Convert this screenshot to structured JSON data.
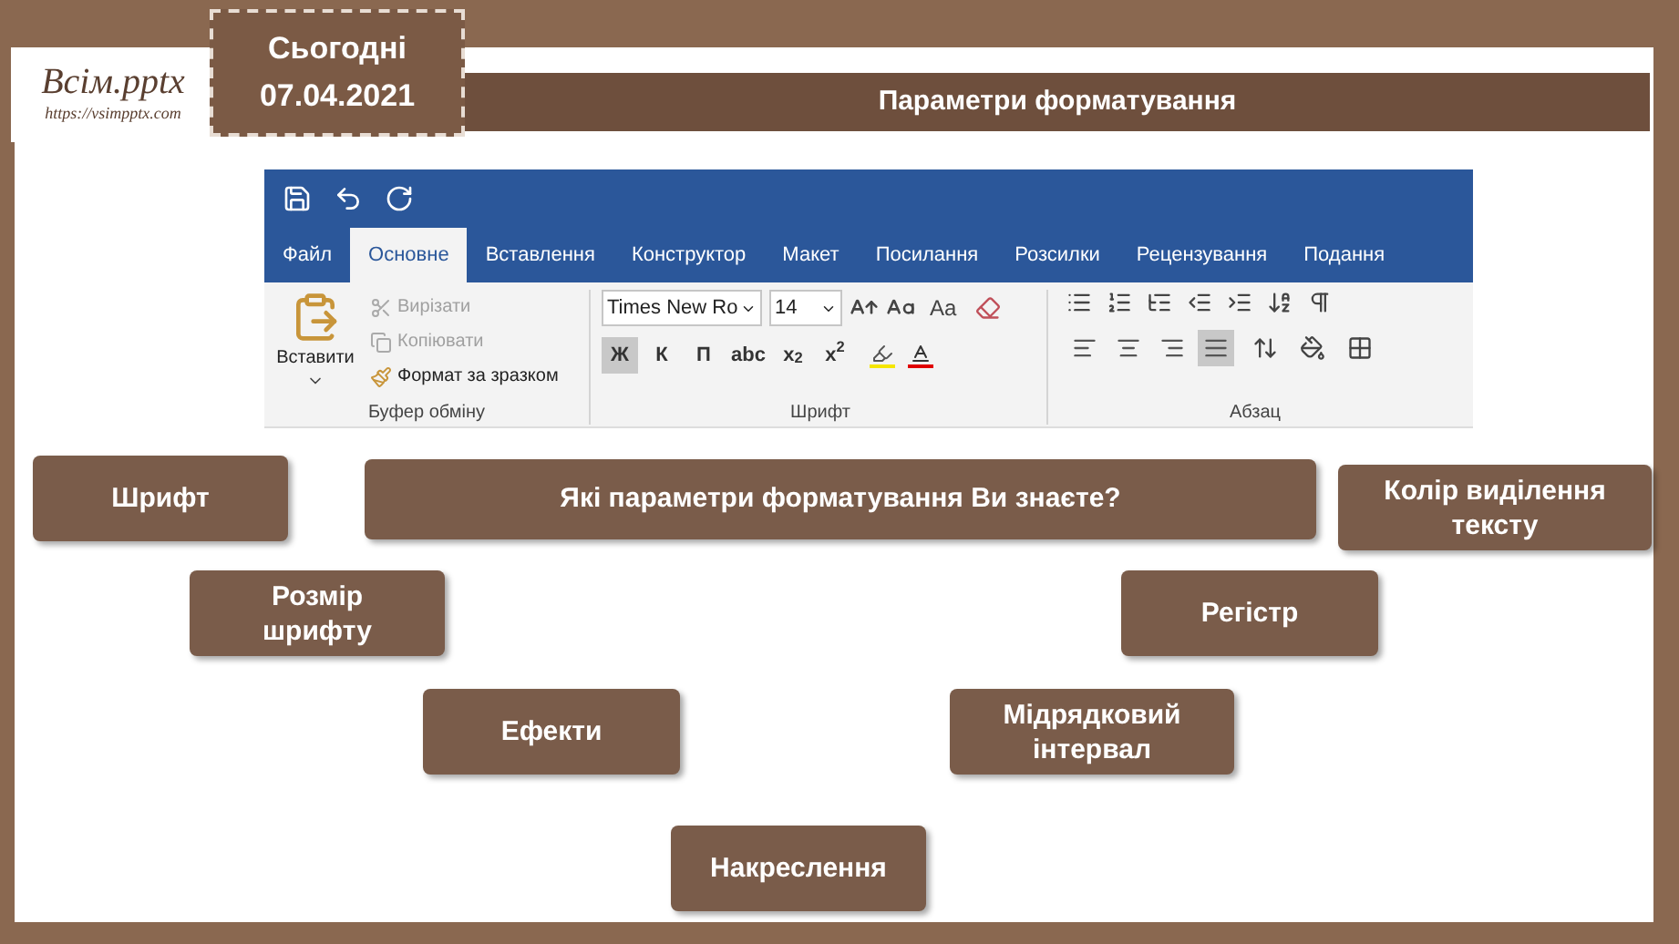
{
  "header": {
    "logo_name": "Всім.pptx",
    "logo_url": "https://vsimpptx.com",
    "date_label": "Сьогодні",
    "date": "07.04.2021"
  },
  "title": "Параметри форматування",
  "ribbon": {
    "tabs": [
      {
        "label": "Файл",
        "selected": false
      },
      {
        "label": "Основне",
        "selected": true
      },
      {
        "label": "Вставлення",
        "selected": false
      },
      {
        "label": "Конструктор",
        "selected": false
      },
      {
        "label": "Макет",
        "selected": false
      },
      {
        "label": "Посилання",
        "selected": false
      },
      {
        "label": "Розсилки",
        "selected": false
      },
      {
        "label": "Рецензування",
        "selected": false
      },
      {
        "label": "Подання",
        "selected": false
      }
    ],
    "clipboard": {
      "paste": "Вставити",
      "items": [
        {
          "kind": "cut",
          "label": "Вирізати",
          "disabled": true
        },
        {
          "kind": "copy",
          "label": "Копіювати",
          "disabled": true
        },
        {
          "kind": "format",
          "label": "Формат за зразком",
          "disabled": false
        }
      ],
      "group_label": "Буфер обміну"
    },
    "font": {
      "font_name": "Times New Ro",
      "font_size": "14",
      "case_button": "Aa",
      "format_buttons": [
        {
          "label": "Ж",
          "selected": true
        },
        {
          "label": "К",
          "selected": false
        },
        {
          "label": "П",
          "selected": false
        },
        {
          "label": "abc",
          "selected": false
        },
        {
          "label": "x$_{2}$",
          "selected": false
        },
        {
          "label": "x$^{2}$",
          "selected": false
        }
      ],
      "group_label": "Шрифт"
    },
    "paragraph": {
      "align_buttons": [
        {
          "kind": "left",
          "selected": false
        },
        {
          "kind": "center",
          "selected": false
        },
        {
          "kind": "right",
          "selected": false
        },
        {
          "kind": "justify",
          "selected": true
        }
      ],
      "group_label": "Абзац"
    }
  },
  "question": "Які параметри форматування Ви знаєте?",
  "topics": [
    {
      "text": "Шрифт"
    },
    {
      "text": "Колір виділення тексту"
    },
    {
      "text": "Розмір шрифту"
    },
    {
      "text": "Регістр"
    },
    {
      "text": "Ефекти"
    },
    {
      "text": "Мідрядковий інтервал"
    },
    {
      "text": "Накреслення"
    }
  ]
}
